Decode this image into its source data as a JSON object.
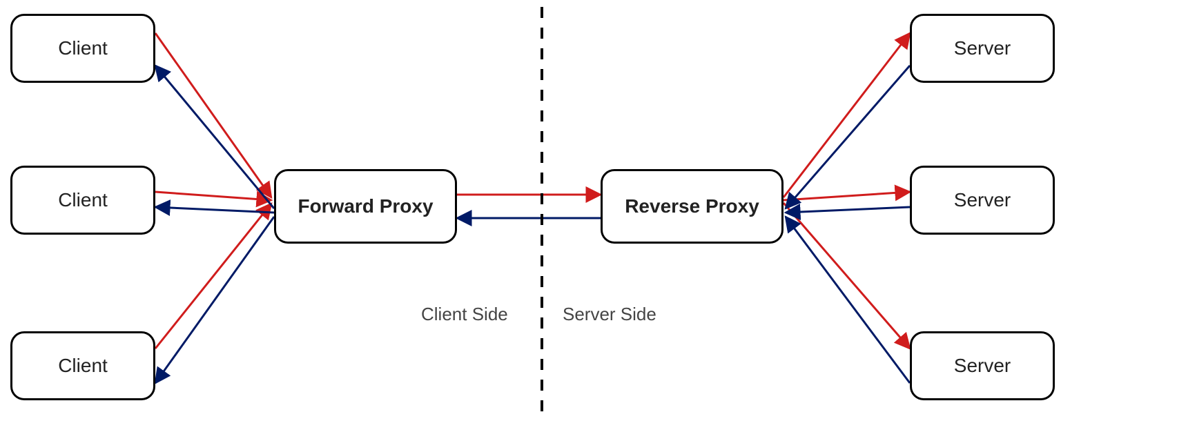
{
  "nodes": {
    "client1": "Client",
    "client2": "Client",
    "client3": "Client",
    "server1": "Server",
    "server2": "Server",
    "server3": "Server",
    "fproxy": "Forward Proxy",
    "rproxy": "Reverse Proxy"
  },
  "labels": {
    "clientSide": "Client Side",
    "serverSide": "Server Side"
  },
  "colors": {
    "request": "#d01c1c",
    "response": "#001a66",
    "border": "#000000"
  }
}
